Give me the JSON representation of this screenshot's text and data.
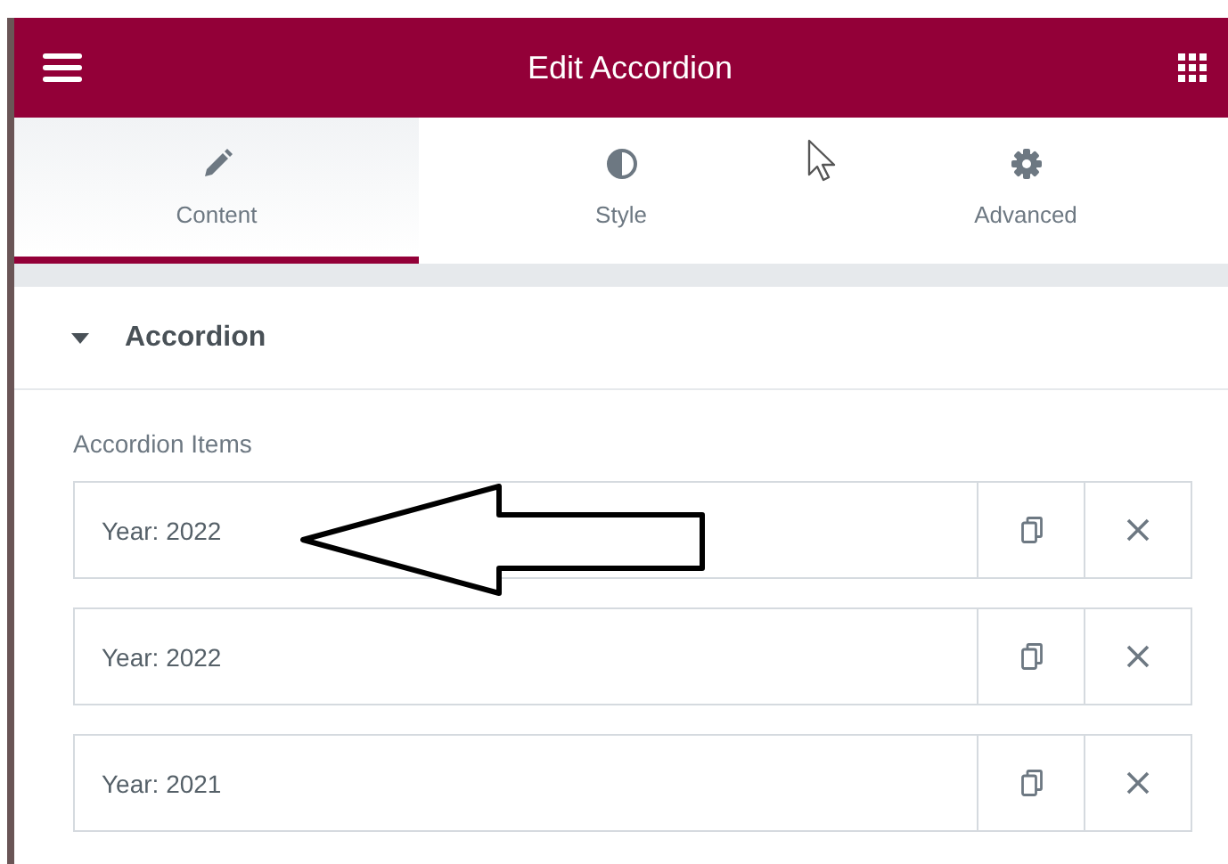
{
  "header": {
    "title": "Edit Accordion"
  },
  "tabs": [
    {
      "label": "Content",
      "kind": "pencil",
      "selected": true
    },
    {
      "label": "Style",
      "kind": "contrast",
      "selected": false
    },
    {
      "label": "Advanced",
      "kind": "gear",
      "selected": false
    }
  ],
  "section": {
    "title": "Accordion",
    "expanded": true
  },
  "repeater": {
    "label": "Accordion Items",
    "items": [
      {
        "title": "Year: 2022"
      },
      {
        "title": "Year: 2022"
      },
      {
        "title": "Year: 2021"
      }
    ]
  }
}
